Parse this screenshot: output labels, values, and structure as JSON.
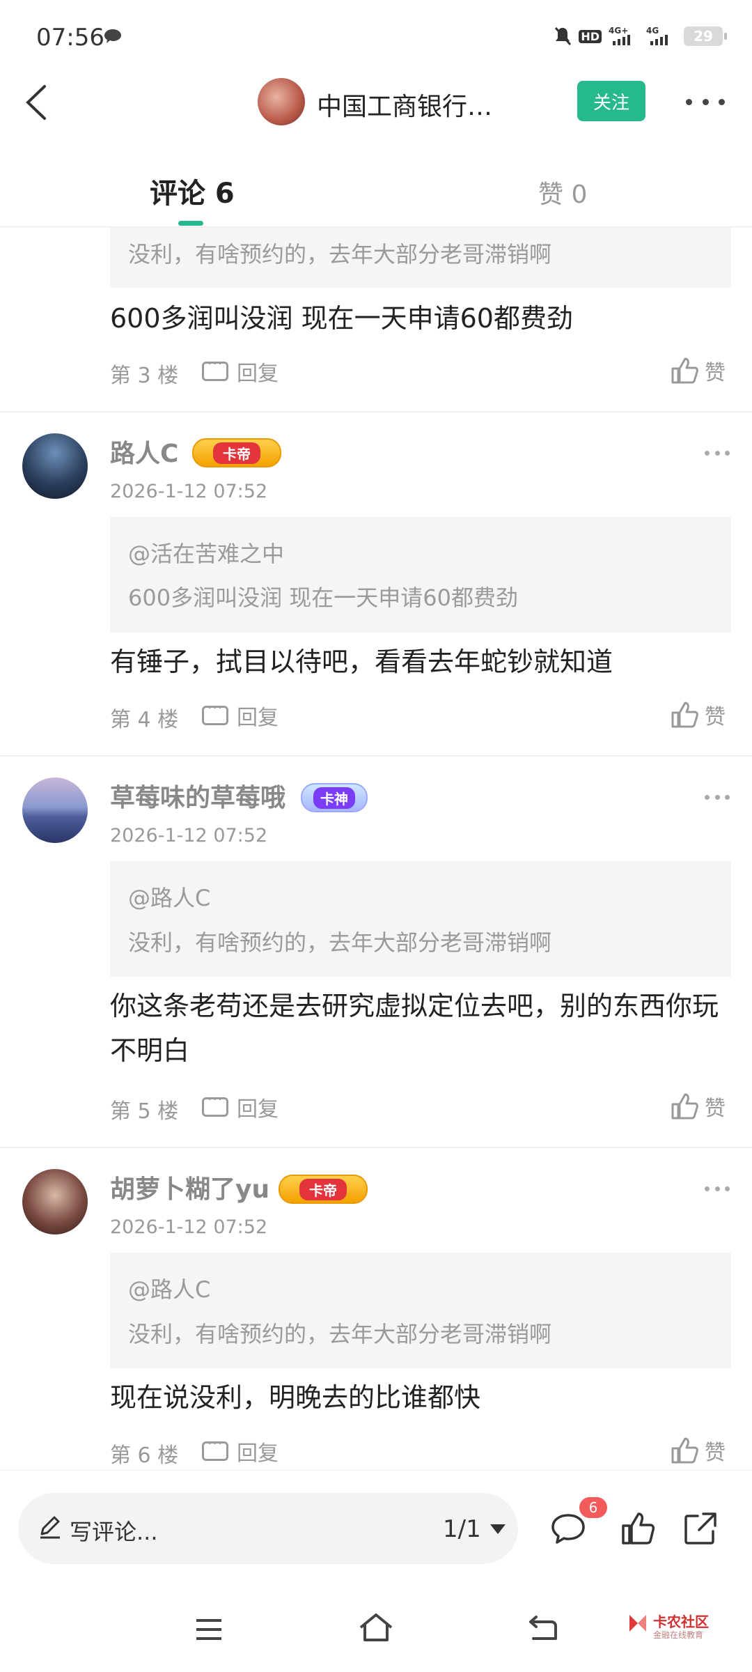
{
  "status_bar": {
    "time": "07:56",
    "battery": "29"
  },
  "header": {
    "title": "中国工商银行…",
    "follow_label": "关注"
  },
  "tabs": [
    {
      "label": "评论 6",
      "active": true
    },
    {
      "label": "赞 0",
      "active": false
    }
  ],
  "comments": [
    {
      "quote_text": "没利，有啥预约的，去年大部分老哥滞销啊",
      "body": "600多润叫没润 现在一天申请60都费劲",
      "floor": "第 3 楼",
      "reply_label": "回复",
      "like_label": "赞"
    },
    {
      "username": "路人C",
      "badge": "卡帝",
      "time": "2026-1-12 07:52",
      "quote_user": "@活在苦难之中",
      "quote_text": "600多润叫没润 现在一天申请60都费劲",
      "body": "有锤子，拭目以待吧，看看去年蛇钞就知道",
      "floor": "第 4 楼",
      "reply_label": "回复",
      "like_label": "赞"
    },
    {
      "username": "草莓味的草莓哦",
      "badge": "卡神",
      "time": "2026-1-12 07:52",
      "quote_user": "@路人C",
      "quote_text": "没利，有啥预约的，去年大部分老哥滞销啊",
      "body": "你这条老苟还是去研究虚拟定位去吧，别的东西你玩不明白",
      "floor": "第 5 楼",
      "reply_label": "回复",
      "like_label": "赞"
    },
    {
      "username": "胡萝卜糊了yu",
      "badge": "卡帝",
      "time": "2026-1-12 07:52",
      "quote_user": "@路人C",
      "quote_text": "没利，有啥预约的，去年大部分老哥滞销啊",
      "body": "现在说没利，明晚去的比谁都快",
      "floor": "第 6 楼",
      "reply_label": "回复",
      "like_label": "赞"
    }
  ],
  "bottom_bar": {
    "write_placeholder": "写评论...",
    "pager": "1/1",
    "comment_count": "6"
  },
  "watermark": {
    "text": "卡农社区",
    "sub": "金融在线教育"
  },
  "colors": {
    "accent": "#26b98d",
    "badge_red": "#f35a5a"
  }
}
